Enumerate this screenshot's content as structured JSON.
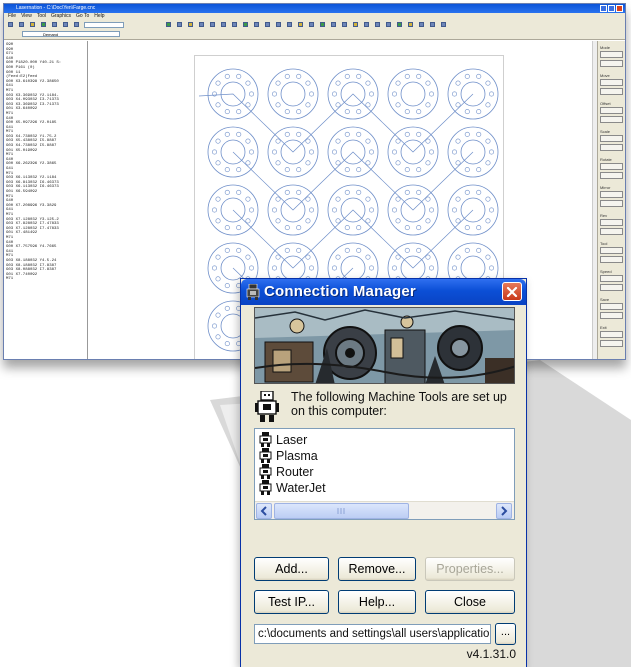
{
  "cad_window": {
    "title": "Lasernation - C:\\Doc\\Yen\\Farge.cnc",
    "menu": [
      "File",
      "View",
      "Tool",
      "Graphics",
      "Go To",
      "Help"
    ],
    "toolbar_field": "Demand",
    "program_listing": [
      "G90",
      "G90",
      "G71",
      "G40",
      "G00 P1820.000 Y40.21 S:",
      "G00 P161 (0)",
      "G00 11",
      "(Feed:E2)Feed",
      "G00 X3.610398 Y2.38650",
      "G41",
      "M71",
      "G03 X3.369032 Y2.1184-",
      "G03 X4.093032 I3.71373",
      "G03 X3.369032 I3.71373",
      "G01 X3.640092",
      "M71",
      "G40",
      "G00 X5.097296 Y2.0185",
      "G41",
      "M71",
      "G03 X4.738032 Y1.75.2",
      "G03 X5.438032 I5.8887",
      "G03 X4.738032 I5.8887",
      "G01 X5.019092",
      "M71",
      "G40",
      "G00 X6.262396 Y2.3865",
      "G41",
      "M71",
      "G03 X6.113032 Y2.1184",
      "G03 X6.813032 I6.46373",
      "G03 X6.113032 I6.46373",
      "G01 X6.594092",
      "M71",
      "G40",
      "G00 X7.208996 Y3.3829",
      "G41",
      "M71",
      "G03 X7.128032 Y3.125-2",
      "G03 X7.828032 I7.47833",
      "G03 X7.128032 I7.47833",
      "G01 X7.481492",
      "M71",
      "G40",
      "G00 X7.757596 Y4.7665",
      "G41",
      "M71",
      "G03 X8.188032 Y4.5.24",
      "G03 X8.188032 I7.8387",
      "G03 X8.088032 I7.8387",
      "G01 X7.740092",
      "M71"
    ],
    "side_panel_labels": [
      "Mode",
      "Move",
      "Offset",
      "Scale",
      "Rotate",
      "Mirror",
      "Rev",
      "Tool",
      "Speed",
      "Save",
      "Exit"
    ]
  },
  "dialog": {
    "title": "Connection Manager",
    "info_text": "The following Machine Tools are set up on this computer:",
    "machines": [
      "Laser",
      "Plasma",
      "Router",
      "WaterJet"
    ],
    "buttons": {
      "add": "Add...",
      "remove": "Remove...",
      "properties": "Properties...",
      "test_ip": "Test IP...",
      "help": "Help...",
      "close": "Close",
      "browse": "..."
    },
    "path_value": "c:\\documents and settings\\all users\\application",
    "version": "v4.1.31.0"
  },
  "colors": {
    "title_bar_blue": "#0b4fd6",
    "dialog_face": "#ece9d8",
    "close_red": "#c9381a",
    "beam_gray": "#d6d6d6"
  }
}
